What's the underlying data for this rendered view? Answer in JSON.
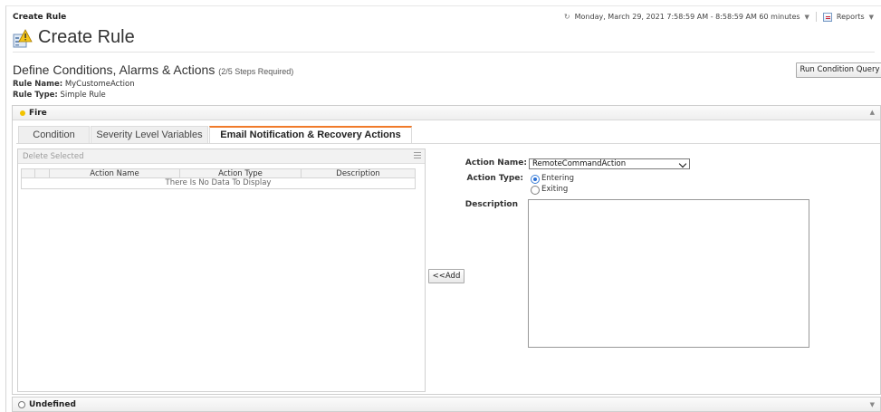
{
  "header": {
    "breadcrumb": "Create Rule",
    "timerange": "Monday, March 29, 2021 7:58:59 AM - 8:58:59 AM 60 minutes",
    "reports_label": "Reports"
  },
  "page": {
    "title": "Create Rule",
    "section_title": "Define Conditions, Alarms & Actions",
    "steps": "(2/5 Steps Required)",
    "rule_name_label": "Rule Name:",
    "rule_name_value": "MyCustomeAction",
    "rule_type_label": "Rule Type:",
    "rule_type_value": "Simple Rule",
    "run_button": "Run Condition Query"
  },
  "panels": {
    "fire_label": "Fire",
    "undefined_label": "Undefined"
  },
  "tabs": [
    {
      "label": "Condition",
      "active": false
    },
    {
      "label": "Severity Level Variables",
      "active": false
    },
    {
      "label": "Email Notification & Recovery Actions",
      "active": true
    }
  ],
  "grid": {
    "delete_label": "Delete Selected",
    "columns": [
      "Action Name",
      "Action Type",
      "Description"
    ],
    "empty_text": "There Is No Data To Display"
  },
  "add_button": "<<Add",
  "form": {
    "action_name_label": "Action Name:",
    "action_name_value": "RemoteCommandAction",
    "action_type_label": "Action Type:",
    "options": [
      {
        "label": "Entering",
        "checked": true
      },
      {
        "label": "Exiting",
        "checked": false
      }
    ],
    "description_label": "Description",
    "description_value": ""
  },
  "colors": {
    "accent_tab": "#f07a2a",
    "fire_status": "#f2c300",
    "radio_selected": "#2a70d6"
  }
}
